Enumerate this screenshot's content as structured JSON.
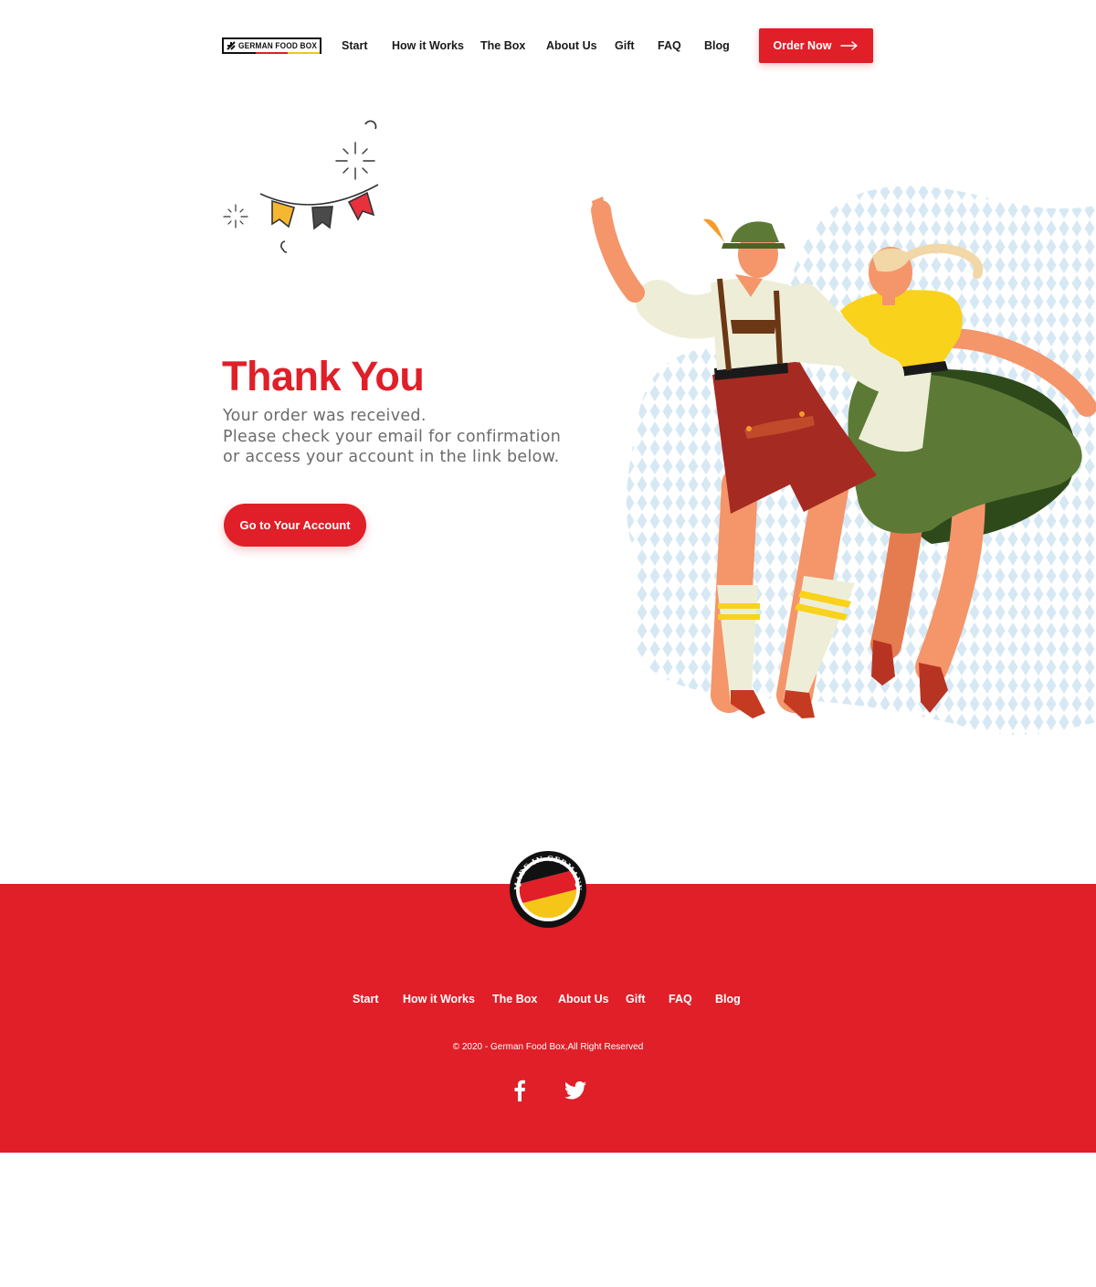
{
  "brand": {
    "logo_text": "GERMAN FOOD BOX",
    "colors": {
      "black": "#111111",
      "red": "#e01f28",
      "gold": "#f5c518"
    }
  },
  "nav": {
    "items": [
      {
        "label": "Start"
      },
      {
        "label": "How it Works"
      },
      {
        "label": "The Box"
      },
      {
        "label": "About Us"
      },
      {
        "label": "Gift"
      },
      {
        "label": "FAQ"
      },
      {
        "label": "Blog"
      }
    ],
    "cta_label": "Order Now",
    "cta_icon": "arrow-right-icon"
  },
  "hero": {
    "title": "Thank You",
    "lines": [
      "Your order was received.",
      "Please check your email for confirmation",
      "or access your account in the link below."
    ],
    "button_label": "Go to Your Account"
  },
  "footer": {
    "badge_text": "MADE IN GERMANY",
    "nav": [
      {
        "label": "Start"
      },
      {
        "label": "How it Works"
      },
      {
        "label": "The Box"
      },
      {
        "label": "About Us"
      },
      {
        "label": "Gift"
      },
      {
        "label": "FAQ"
      },
      {
        "label": "Blog"
      }
    ],
    "copyright": "© 2020 - German Food Box,All Right Reserved",
    "social": [
      "facebook-icon",
      "twitter-icon"
    ]
  }
}
